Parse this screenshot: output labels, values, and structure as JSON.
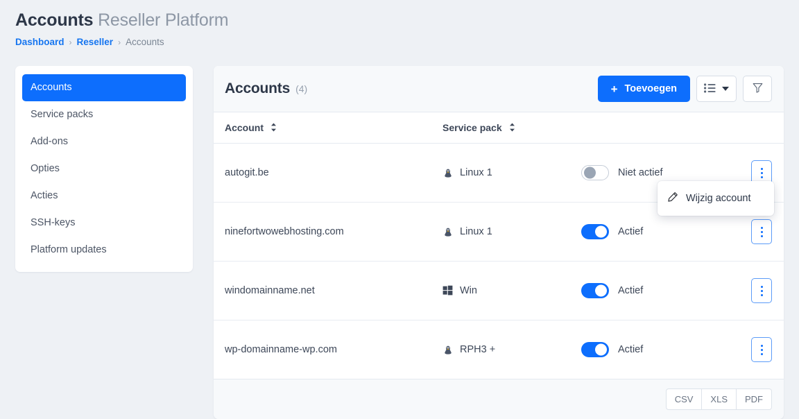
{
  "header": {
    "title_strong": "Accounts",
    "title_rest": "Reseller Platform",
    "breadcrumb": [
      {
        "label": "Dashboard",
        "type": "link"
      },
      {
        "label": "Reseller",
        "type": "link"
      },
      {
        "label": "Accounts",
        "type": "current"
      }
    ],
    "separator": "›"
  },
  "sidebar": {
    "items": [
      {
        "label": "Accounts",
        "active": true
      },
      {
        "label": "Service packs",
        "active": false
      },
      {
        "label": "Add-ons",
        "active": false
      },
      {
        "label": "Opties",
        "active": false
      },
      {
        "label": "Acties",
        "active": false
      },
      {
        "label": "SSH-keys",
        "active": false
      },
      {
        "label": "Platform updates",
        "active": false
      }
    ]
  },
  "card": {
    "title": "Accounts",
    "count": "(4)",
    "add_button": "Toevoegen",
    "add_icon": "plus-icon",
    "view_icon": "list-view-icon",
    "filter_icon": "funnel-filter-icon",
    "columns": {
      "account": "Account",
      "service_pack": "Service pack"
    },
    "rows": [
      {
        "account": "autogit.be",
        "service_pack": "Linux 1",
        "os_icon": "linux-penguin-icon",
        "active": false,
        "status_label": "Niet actief"
      },
      {
        "account": "ninefortwowebhosting.com",
        "service_pack": "Linux 1",
        "os_icon": "linux-penguin-icon",
        "active": true,
        "status_label": "Actief"
      },
      {
        "account": "windomainname.net",
        "service_pack": "Win",
        "os_icon": "windows-icon",
        "active": true,
        "status_label": "Actief"
      },
      {
        "account": "wp-domainname-wp.com",
        "service_pack": "RPH3 +",
        "os_icon": "linux-penguin-icon",
        "active": true,
        "status_label": "Actief"
      }
    ],
    "menu": {
      "items": [
        {
          "label": "Wijzig account",
          "icon": "pencil-edit-icon"
        }
      ]
    },
    "export": [
      "CSV",
      "XLS",
      "PDF"
    ]
  },
  "colors": {
    "accent": "#0d6efd",
    "page_bg": "#eef1f5",
    "panel_bg": "#f7f9fb",
    "text": "#3d4758",
    "muted": "#97a1af"
  }
}
